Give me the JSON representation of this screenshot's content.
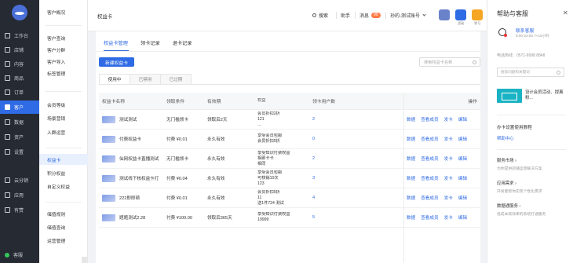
{
  "app": {
    "title": "权益卡"
  },
  "primary_nav": {
    "items": [
      {
        "label": "工作台",
        "icon": "desktop-icon"
      },
      {
        "label": "店铺",
        "icon": "shop-icon"
      },
      {
        "label": "内容",
        "icon": "content-icon"
      },
      {
        "label": "商品",
        "icon": "goods-icon"
      },
      {
        "label": "订单",
        "icon": "order-icon"
      },
      {
        "label": "客户",
        "icon": "customer-icon"
      },
      {
        "label": "数据",
        "icon": "data-icon"
      },
      {
        "label": "资产",
        "icon": "asset-icon"
      },
      {
        "label": "设置",
        "icon": "settings-icon"
      },
      {
        "label": "云分销",
        "icon": "distribution-icon"
      },
      {
        "label": "应用",
        "icon": "apps-icon"
      },
      {
        "label": "有赞",
        "icon": "youzan-icon"
      }
    ],
    "status": "客服"
  },
  "secondary_nav": {
    "groups": [
      [
        "客户概况"
      ],
      [
        "客户查询",
        "客户分群",
        "客户导入",
        "标签管理"
      ],
      [
        "会员等级",
        "场景营销",
        "人群运营"
      ],
      [
        "权益卡",
        "积分权益",
        "自定义权益"
      ],
      [
        "储值规则",
        "储值查询",
        "运营管理"
      ]
    ]
  },
  "header": {
    "page_title": "权益卡",
    "search_label": "搜索",
    "help_label": "助手",
    "messages_label": "消息",
    "messages_badge": "99",
    "account_label": "孙的-测试账号",
    "icon_labels": [
      "",
      "活动",
      "学习"
    ]
  },
  "main": {
    "tabs": [
      "权益卡管理",
      "领卡记录",
      "退卡记录"
    ],
    "new_button": "新建权益卡",
    "search_placeholder": "搜索权益卡名称",
    "subtabs": [
      "使用中",
      "已禁用",
      "已过期"
    ],
    "table": {
      "columns": [
        "权益卡名称",
        "领取条件",
        "有效期",
        "权益",
        "领卡用户数",
        "操作"
      ],
      "rows": [
        {
          "name": "测试测试",
          "condition": "无门槛领卡",
          "validity": "领取后2天",
          "benefits": [
            "会员折扣2折",
            "121",
            "..."
          ],
          "users": "2",
          "ops": [
            "数据",
            "查看成员",
            "发卡",
            "编辑"
          ]
        },
        {
          "name": "付费权益卡",
          "condition": "付费 ¥0.01",
          "validity": "永久有效",
          "benefits": [
            "享受会员包邮",
            "会员折扣5折"
          ],
          "users": "0",
          "ops": [
            "数据",
            "查看成员",
            "发卡",
            "编辑"
          ]
        },
        {
          "name": "仙网权益卡直播测试",
          "condition": "无门槛领卡",
          "validity": "永久有效",
          "benefits": [
            "享受知识付费权益",
            "相即卡卡",
            "相同"
          ],
          "users": "2",
          "ops": [
            "数据",
            "查看成员",
            "发卡",
            "编辑"
          ]
        },
        {
          "name": "测试线下核权益卡打",
          "condition": "付费 ¥0.04",
          "validity": "永久有效",
          "benefits": [
            "享受会员包邮",
            "可核销10次",
            "123"
          ],
          "users": "3",
          "ops": [
            "数据",
            "查看成员",
            "发卡",
            "编辑"
          ]
        },
        {
          "name": "222即即顿",
          "condition": "付费 ¥0.01",
          "validity": "永久有效",
          "benefits": [
            "会员折扣5折",
            "11",
            "送1件724 测试"
          ],
          "users": "4",
          "ops": [
            "数据",
            "查看成员",
            "发卡",
            "编辑"
          ]
        },
        {
          "name": "题题测试2.28",
          "condition": "付费 ¥100.00",
          "validity": "领取后365天",
          "benefits": [
            "享受知识付费权益",
            "19999"
          ],
          "users": "5",
          "ops": [
            "数据",
            "查看成员",
            "发卡",
            "编辑"
          ]
        }
      ]
    }
  },
  "help_panel": {
    "title": "帮助与客服",
    "cs_name": "联系客服",
    "cs_hours": "9:00-23:00 7×15小时",
    "phone": "电话热线：0571-8998 8848",
    "search_placeholder": "搜索问题和关键词",
    "promo_text": "设计会员活动、提离粉...",
    "guide_title": "办卡设置使用教程",
    "help_center": "帮助中心",
    "services": [
      {
        "title": "服务市场 ›",
        "desc": "为你提供店铺运营解决方案"
      },
      {
        "title": "应用需求 ›",
        "desc": "开发者帮你实现个性化需求"
      },
      {
        "title": "数据通服务 ›",
        "desc": "低成本高效率的系统打通服务"
      }
    ]
  },
  "colors": {
    "accent": "#2f6be4",
    "sidebar": "#262a33",
    "badge": "#ff7a45"
  }
}
